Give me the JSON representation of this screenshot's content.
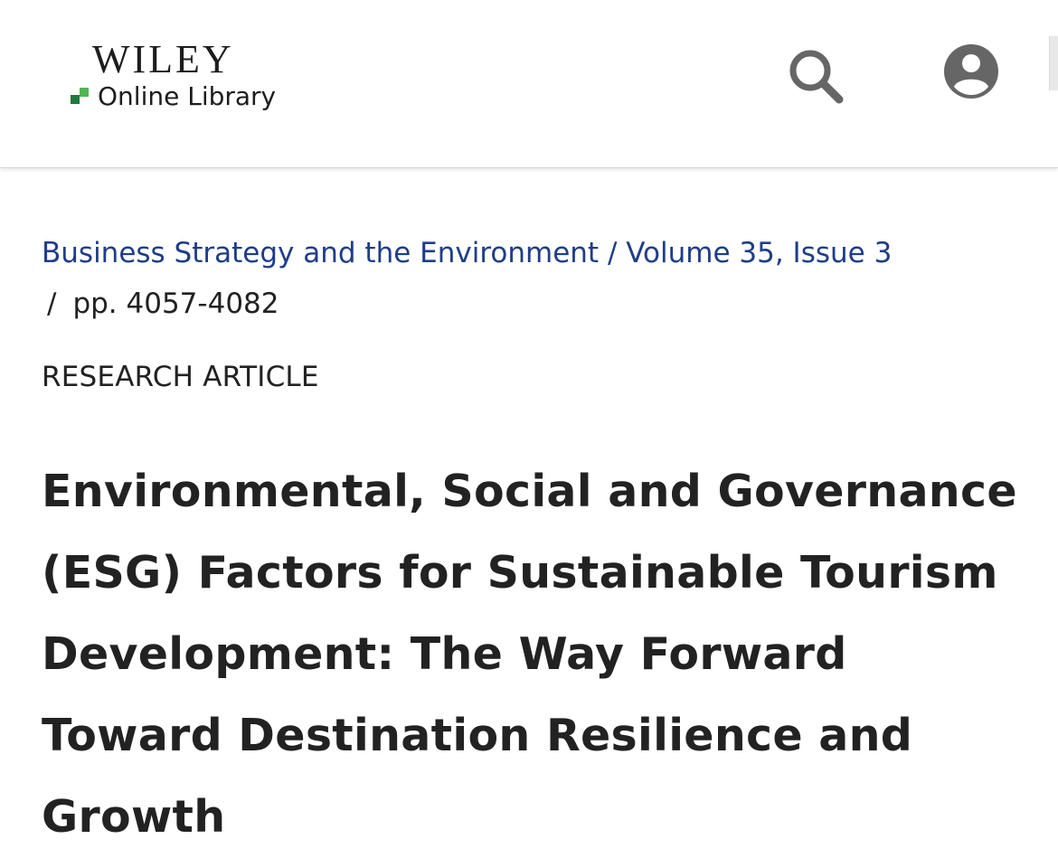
{
  "header": {
    "logo": {
      "brand": "WILEY",
      "subtitle": "Online Library",
      "mark_colors": [
        "#1f7a3f",
        "#52b553"
      ]
    },
    "icons": {
      "search": "search-icon",
      "account": "account-circle-icon"
    }
  },
  "breadcrumb": {
    "journal": "Business Strategy and the Environment",
    "separator": " / ",
    "issue": "Volume 35, Issue 3",
    "pages_separator": "/",
    "pages": "pp. 4057-4082"
  },
  "article": {
    "type": "RESEARCH ARTICLE",
    "title": "Environmental, Social and Governance (ESG) Factors for Sustainable Tourism Development: The Way Forward Toward Destination Resilience and Growth"
  },
  "colors": {
    "link": "#1e3d8a",
    "text": "#222222",
    "icon": "#666666"
  }
}
